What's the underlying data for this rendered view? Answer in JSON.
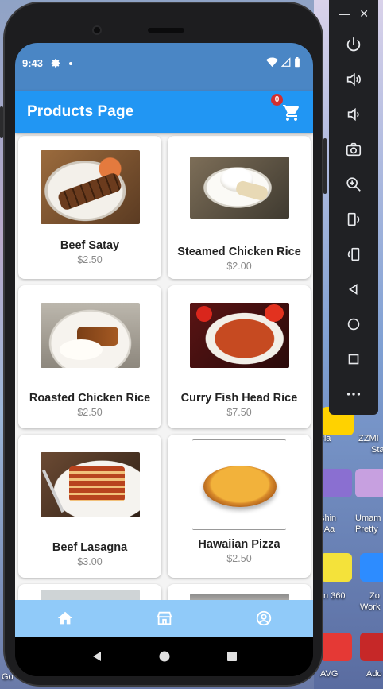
{
  "status_bar": {
    "time": "9:43"
  },
  "app_bar": {
    "title": "Products Page",
    "cart_count": "0"
  },
  "products": [
    {
      "name": "Beef Satay",
      "price": "$2.50",
      "image": "beef-satay-photo"
    },
    {
      "name": "Steamed Chicken Rice",
      "price": "$2.00",
      "image": "steamed-chicken-rice-photo"
    },
    {
      "name": "Roasted Chicken Rice",
      "price": "$2.50",
      "image": "roasted-chicken-rice-photo"
    },
    {
      "name": "Curry Fish Head Rice",
      "price": "$7.50",
      "image": "curry-fish-head-photo"
    },
    {
      "name": "Beef Lasagna",
      "price": "$3.00",
      "image": "beef-lasagna-photo"
    },
    {
      "name": "Hawaiian Pizza",
      "price": "$2.50",
      "image": "hawaiian-pizza-photo"
    }
  ],
  "bottom_nav": {
    "items": [
      "home-icon",
      "store-icon",
      "account-icon"
    ]
  },
  "colors": {
    "app_bar": "#2196f3",
    "status_bar": "#4a86c5",
    "bottom_nav": "#90caf9",
    "badge": "#d32f2f"
  },
  "desktop": {
    "labels": [
      "ZZMI",
      "Sta",
      "tiPla",
      "Umam",
      "Pretty",
      "shin",
      "t-Aa",
      "n 360",
      "Zo",
      "Work",
      "AVG",
      "Ado",
      "Go"
    ]
  }
}
